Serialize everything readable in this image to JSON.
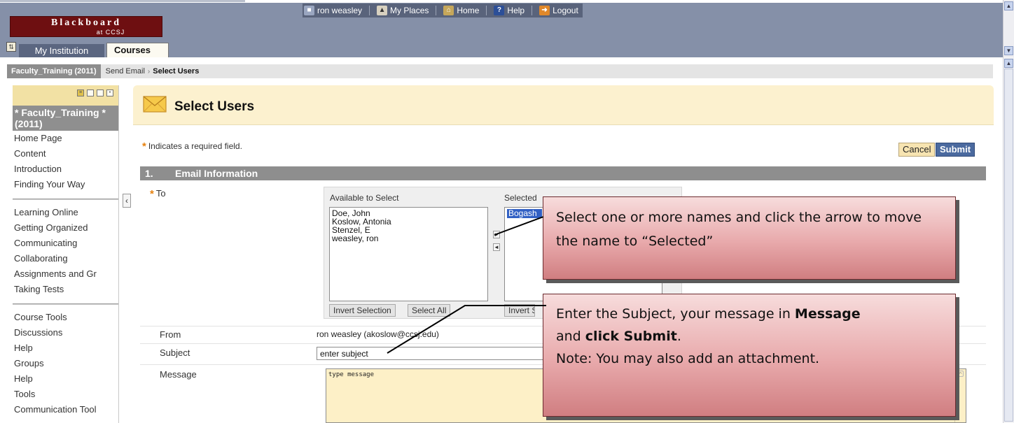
{
  "header": {
    "logo_line1": "Blackboard",
    "logo_line2": "at CCSJ",
    "nav": {
      "user": "ron weasley",
      "my_places": "My Places",
      "home": "Home",
      "help": "Help",
      "logout": "Logout"
    },
    "tabs": {
      "institution": "My Institution",
      "courses": "Courses"
    }
  },
  "breadcrumb": {
    "course": "Faculty_Training (2011)",
    "middle": "Send Email",
    "separator": "›",
    "current": "Select Users"
  },
  "left_menu": {
    "title": "* Faculty_Training * (2011)",
    "group1": [
      "Home Page",
      "Content",
      "Introduction",
      "Finding Your Way"
    ],
    "group2": [
      "Learning Online",
      "Getting Organized",
      "Communicating",
      "Collaborating",
      "Assignments and Gr",
      "Taking Tests"
    ],
    "group3": [
      "Course Tools",
      "Discussions",
      "Help",
      "Groups",
      "Help",
      "Tools",
      "Communication Tool"
    ]
  },
  "page": {
    "title": "Select Users",
    "required_star": "*",
    "required_note": "Indicates a required field.",
    "cancel_label": "Cancel",
    "submit_label": "Submit"
  },
  "section": {
    "number": "1.",
    "title": "Email Information"
  },
  "form": {
    "to_label": "To",
    "available_label": "Available to Select",
    "selected_label": "Selected",
    "available_items": [
      "Doe, John",
      "Koslow, Antonia",
      "Stenzel, E",
      "weasley, ron"
    ],
    "selected_items": [
      "Bogash"
    ],
    "invert_selection_label": "Invert Selection",
    "select_all_label": "Select All",
    "invert_right_label": "Invert S",
    "from_label": "From",
    "from_value": "ron weasley (akoslow@ccsj.edu)",
    "subject_label": "Subject",
    "subject_value": "enter subject",
    "message_label": "Message",
    "message_value": "type message"
  },
  "callouts": {
    "first": "Select one or more names and click the arrow to move the name to “Selected”",
    "second_part1": "Enter the Subject, your message in",
    "second_bold1": "Message",
    "second_part2": "and",
    "second_bold2": "click Submit",
    "second_part3": ".",
    "second_note": "Note:  You may also add an attachment."
  },
  "colors": {
    "header": "#8590a8",
    "logo": "#6e0f11",
    "title_bar": "#fcf1cf",
    "section_bar": "#8e8e8e",
    "submit": "#4b6a9f",
    "required_star": "#e6810e",
    "callout": "#e8a9ab"
  },
  "icons": {
    "title": "envelope-icon",
    "user": "user-icon",
    "my_places": "places-icon",
    "home": "home-icon",
    "help": "help-icon",
    "logout": "logout-icon"
  }
}
